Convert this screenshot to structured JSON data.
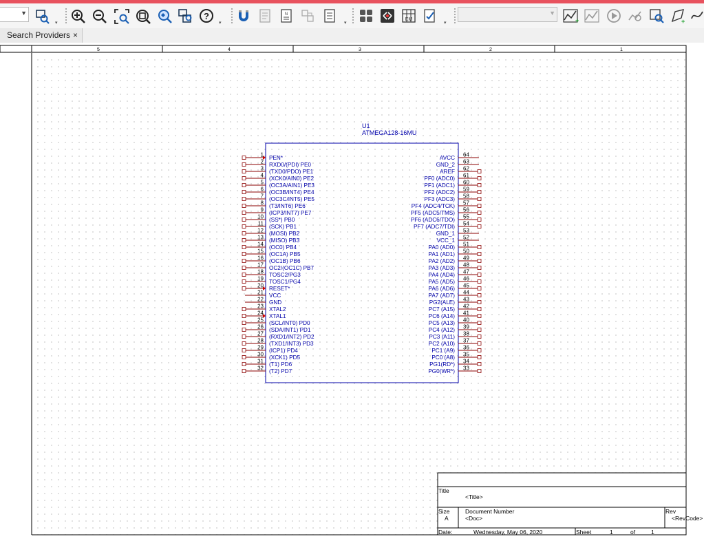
{
  "toolbar": {
    "buttons": [
      {
        "name": "find-icon",
        "icon": "find-parts"
      },
      {
        "name": "zoom-in-icon",
        "icon": "zoom-in"
      },
      {
        "name": "zoom-out-icon",
        "icon": "zoom-out"
      },
      {
        "name": "zoom-area-icon",
        "icon": "zoom-area"
      },
      {
        "name": "zoom-fit-icon",
        "icon": "zoom-fit"
      },
      {
        "name": "zoom-selection-icon",
        "icon": "zoom-selection"
      },
      {
        "name": "zoom-all-icon",
        "icon": "zoom-all"
      },
      {
        "name": "help-icon",
        "icon": "help"
      },
      {
        "name": "magnet-icon",
        "icon": "snap"
      },
      {
        "name": "part-properties-icon",
        "icon": "properties"
      },
      {
        "name": "netlist-icon",
        "icon": "netlist"
      },
      {
        "name": "annotate-icon",
        "icon": "annotate"
      },
      {
        "name": "bom-icon",
        "icon": "bill-of-materials"
      },
      {
        "name": "component-grid-icon",
        "icon": "grid"
      },
      {
        "name": "drc-icon",
        "icon": "design-rules"
      },
      {
        "name": "em-grid-icon",
        "icon": "em"
      },
      {
        "name": "checklist-icon",
        "icon": "check"
      },
      {
        "name": "simulate-profile-icon",
        "icon": "new-profile"
      },
      {
        "name": "edit-profile-icon",
        "icon": "edit-profile"
      },
      {
        "name": "run-icon",
        "icon": "run"
      },
      {
        "name": "view-results-icon",
        "icon": "results"
      },
      {
        "name": "probe-icon",
        "icon": "probe"
      },
      {
        "name": "marker-icon",
        "icon": "marker"
      },
      {
        "name": "voltage-marker-icon",
        "icon": "voltage-marker"
      }
    ],
    "combo_left": {
      "value": ""
    },
    "combo_profile": {
      "value": ""
    }
  },
  "tabs": [
    {
      "label": "Search Providers",
      "close": "×"
    }
  ],
  "ruler": {
    "labels": [
      "5",
      "4",
      "3",
      "2",
      "1"
    ]
  },
  "component": {
    "ref": "U1",
    "value": "ATMEGA128-16MU",
    "left_pins": [
      {
        "num": "1",
        "name": "PEN*",
        "marker": "clock"
      },
      {
        "num": "2",
        "name": "RXD0/(PDI) PE0",
        "marker": "none"
      },
      {
        "num": "3",
        "name": "(TXD0/PDO) PE1",
        "marker": "none"
      },
      {
        "num": "4",
        "name": "(XCK0/AIN0) PE2",
        "marker": "none"
      },
      {
        "num": "5",
        "name": "(OC3A/AIN1) PE3",
        "marker": "none"
      },
      {
        "num": "6",
        "name": "(OC3B/INT4) PE4",
        "marker": "none"
      },
      {
        "num": "7",
        "name": "(OC3C/INT5) PE5",
        "marker": "none"
      },
      {
        "num": "8",
        "name": "(T3/INT6) PE6",
        "marker": "none"
      },
      {
        "num": "9",
        "name": "(ICP3/INT7) PE7",
        "marker": "none"
      },
      {
        "num": "10",
        "name": "(SS*) PB0",
        "marker": "none"
      },
      {
        "num": "11",
        "name": "(SCK) PB1",
        "marker": "none"
      },
      {
        "num": "12",
        "name": "(MOSI) PB2",
        "marker": "none"
      },
      {
        "num": "13",
        "name": "(MISO) PB3",
        "marker": "none"
      },
      {
        "num": "14",
        "name": "(OC0) PB4",
        "marker": "none"
      },
      {
        "num": "15",
        "name": "(OC1A) PB5",
        "marker": "none"
      },
      {
        "num": "16",
        "name": "(OC1B) PB6",
        "marker": "none"
      },
      {
        "num": "17",
        "name": "OC2/(OC1C) PB7",
        "marker": "none"
      },
      {
        "num": "18",
        "name": "TOSC2/PG3",
        "marker": "none"
      },
      {
        "num": "19",
        "name": "TOSC1/PG4",
        "marker": "none"
      },
      {
        "num": "20",
        "name": "RESET*",
        "marker": "clock"
      },
      {
        "num": "21",
        "name": "VCC",
        "marker": "power"
      },
      {
        "num": "22",
        "name": "GND",
        "marker": "power"
      },
      {
        "num": "23",
        "name": "XTAL2",
        "marker": "none"
      },
      {
        "num": "24",
        "name": "XTAL1",
        "marker": "clock"
      },
      {
        "num": "25",
        "name": "(SCL/INT0) PD0",
        "marker": "none"
      },
      {
        "num": "26",
        "name": "(SDA/INT1) PD1",
        "marker": "none"
      },
      {
        "num": "27",
        "name": "(RXD1/INT2) PD2",
        "marker": "none"
      },
      {
        "num": "28",
        "name": "(TXD1/INT3) PD3",
        "marker": "none"
      },
      {
        "num": "29",
        "name": "(ICP1) PD4",
        "marker": "none"
      },
      {
        "num": "30",
        "name": "(XCK1) PD5",
        "marker": "none"
      },
      {
        "num": "31",
        "name": "(T1) PD6",
        "marker": "none"
      },
      {
        "num": "32",
        "name": "(T2) PD7",
        "marker": "none"
      }
    ],
    "right_pins": [
      {
        "num": "64",
        "name": "AVCC",
        "marker": "power"
      },
      {
        "num": "63",
        "name": "GND_2",
        "marker": "power"
      },
      {
        "num": "62",
        "name": "AREF",
        "marker": "none"
      },
      {
        "num": "61",
        "name": "PF0 (ADC0)",
        "marker": "none"
      },
      {
        "num": "60",
        "name": "PF1 (ADC1)",
        "marker": "none"
      },
      {
        "num": "59",
        "name": "PF2 (ADC2)",
        "marker": "none"
      },
      {
        "num": "58",
        "name": "PF3 (ADC3)",
        "marker": "none"
      },
      {
        "num": "57",
        "name": "PF4 (ADC4/TCK)",
        "marker": "none"
      },
      {
        "num": "56",
        "name": "PF5 (ADC5/TMS)",
        "marker": "none"
      },
      {
        "num": "55",
        "name": "PF6 (ADC6/TDO)",
        "marker": "none"
      },
      {
        "num": "54",
        "name": "PF7 (ADC7/TDI)",
        "marker": "none"
      },
      {
        "num": "53",
        "name": "GND_1",
        "marker": "power"
      },
      {
        "num": "52",
        "name": "VCC_1",
        "marker": "power"
      },
      {
        "num": "51",
        "name": "PA0 (AD0)",
        "marker": "none"
      },
      {
        "num": "50",
        "name": "PA1 (AD1)",
        "marker": "none"
      },
      {
        "num": "49",
        "name": "PA2 (AD2)",
        "marker": "none"
      },
      {
        "num": "48",
        "name": "PA3 (AD3)",
        "marker": "none"
      },
      {
        "num": "47",
        "name": "PA4 (AD4)",
        "marker": "none"
      },
      {
        "num": "46",
        "name": "PA5 (AD5)",
        "marker": "none"
      },
      {
        "num": "45",
        "name": "PA6 (AD6)",
        "marker": "none"
      },
      {
        "num": "44",
        "name": "PA7 (AD7)",
        "marker": "none"
      },
      {
        "num": "43",
        "name": "PG2(ALE)",
        "marker": "none"
      },
      {
        "num": "42",
        "name": "PC7 (A15)",
        "marker": "none"
      },
      {
        "num": "41",
        "name": "PC6 (A14)",
        "marker": "none"
      },
      {
        "num": "40",
        "name": "PC5 (A13)",
        "marker": "none"
      },
      {
        "num": "39",
        "name": "PC4 (A12)",
        "marker": "none"
      },
      {
        "num": "38",
        "name": "PC3 (A11)",
        "marker": "none"
      },
      {
        "num": "37",
        "name": "PC2 (A10)",
        "marker": "none"
      },
      {
        "num": "36",
        "name": "PC1 (A9)",
        "marker": "none"
      },
      {
        "num": "35",
        "name": "PC0 (A8)",
        "marker": "none"
      },
      {
        "num": "34",
        "name": "PG1(RD*)",
        "marker": "none"
      },
      {
        "num": "33",
        "name": "PG0(WR*)",
        "marker": "none"
      }
    ]
  },
  "title_block": {
    "title_label": "Title",
    "title_value": "<Title>",
    "size_label": "Size",
    "size_value": "A",
    "docnum_label": "Document Number",
    "docnum_value": "<Doc>",
    "rev_label": "Rev",
    "rev_value": "<RevCode>",
    "date_label": "Date:",
    "date_value": "Wednesday, May 06, 2020",
    "sheet_label": "Sheet",
    "sheet_value": "1",
    "of_label": "of",
    "of_value": "1"
  },
  "colors": {
    "part_blue": "#0000aa",
    "pin_red": "#8b0000",
    "clock_red": "#cc0000",
    "frame": "#000000",
    "grid_dot": "#c6c6c6",
    "accent_bar": "#e8525e"
  }
}
